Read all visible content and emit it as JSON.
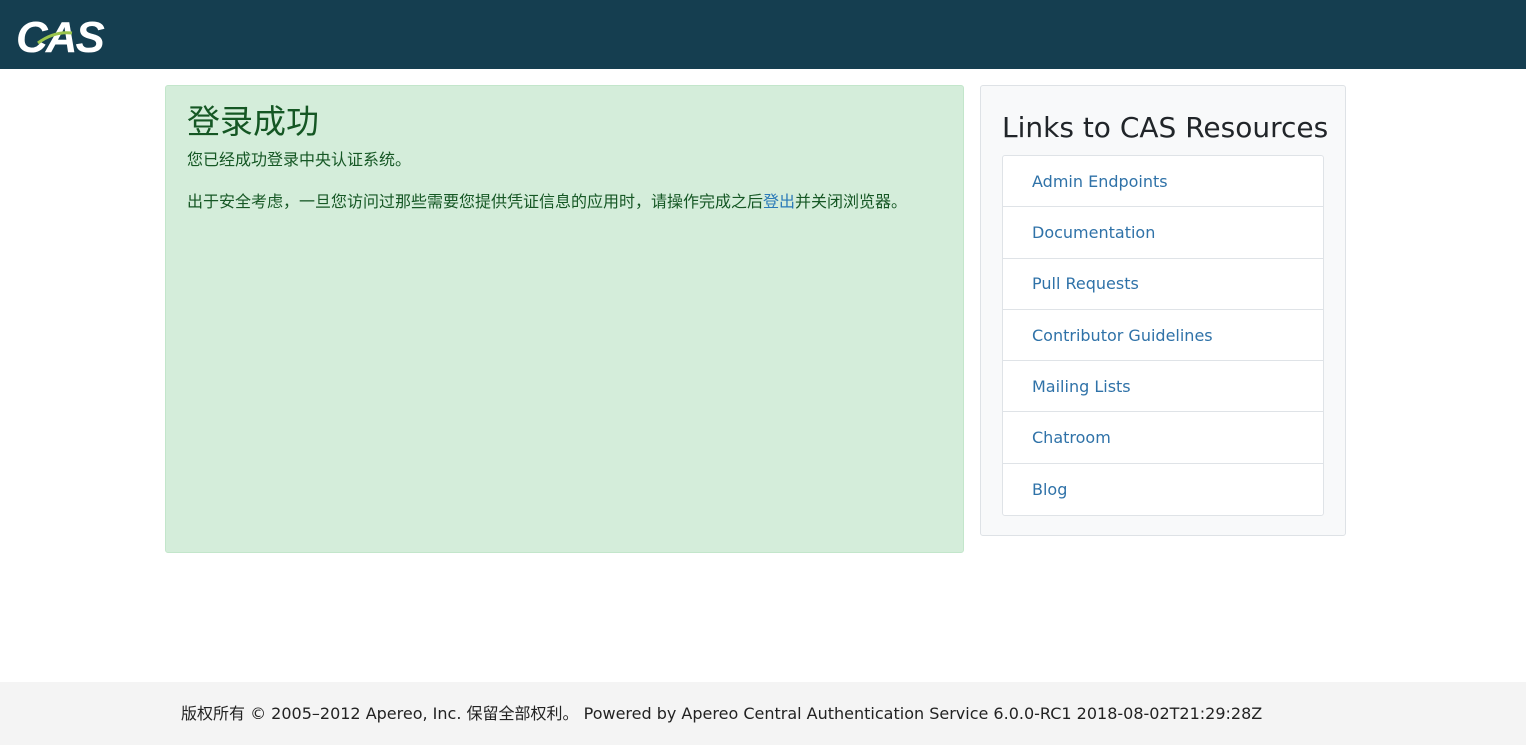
{
  "colors": {
    "header_bg": "#153e50",
    "success_bg": "#d4edda",
    "success_text": "#155724",
    "link": "#2f72a8",
    "logo_accent": "#9bc54c"
  },
  "header": {
    "logo_text": "CAS"
  },
  "success": {
    "title": "登录成功",
    "message": "您已经成功登录中央认证系统。",
    "security_before": "出于安全考虑，一旦您访问过那些需要您提供凭证信息的应用时，请操作完成之后",
    "logout_link": "登出",
    "security_after": "并关闭浏览器。"
  },
  "resources": {
    "title": "Links to CAS Resources",
    "items": [
      {
        "label": "Admin Endpoints"
      },
      {
        "label": "Documentation"
      },
      {
        "label": "Pull Requests"
      },
      {
        "label": "Contributor Guidelines"
      },
      {
        "label": "Mailing Lists"
      },
      {
        "label": "Chatroom"
      },
      {
        "label": "Blog"
      }
    ]
  },
  "footer": {
    "copyright": "版权所有 © 2005–2012 Apereo, Inc. 保留全部权利。",
    "powered_by": "Powered by Apereo Central Authentication Service 6.0.0-RC1 2018-08-02T21:29:28Z"
  }
}
